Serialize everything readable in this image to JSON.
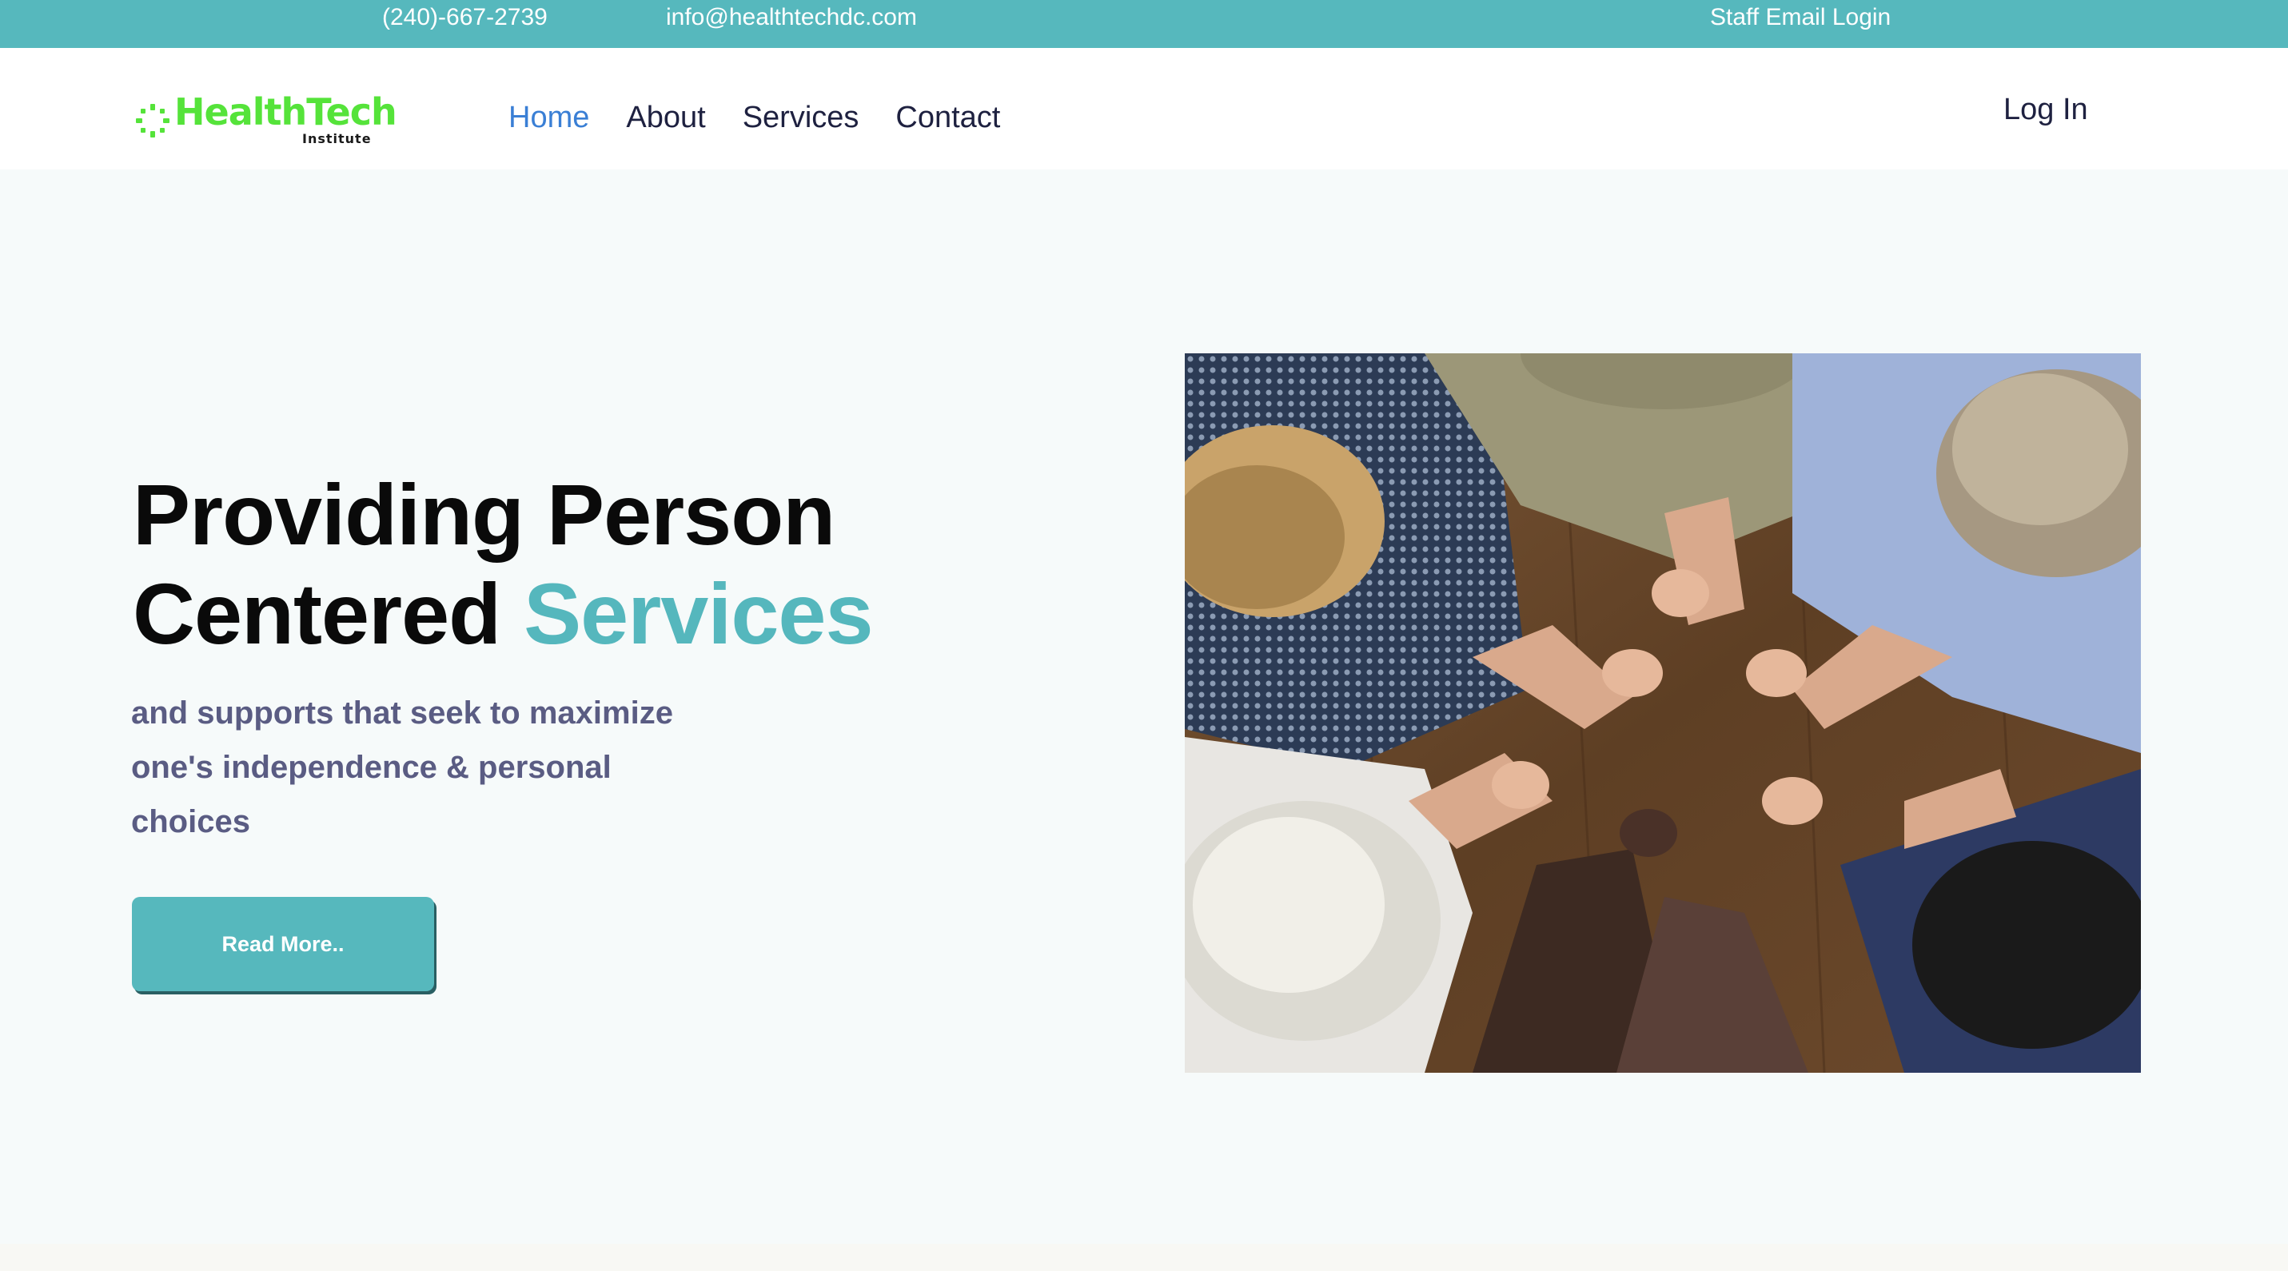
{
  "topbar": {
    "phone": "(240)-667-2739",
    "email": "info@healthtechdc.com",
    "staff_login": "Staff Email Login"
  },
  "brand": {
    "name": "HealthTech",
    "sub": "Institute",
    "primary_color": "#55e33a",
    "accent_color": "#56b8bd"
  },
  "nav": {
    "items": [
      {
        "label": "Home",
        "active": true
      },
      {
        "label": "About"
      },
      {
        "label": "Services"
      },
      {
        "label": "Contact"
      }
    ],
    "login": "Log In"
  },
  "hero": {
    "title_line1": "Providing Person",
    "title_line2": "Centered ",
    "title_accent": "Services",
    "subtitle": "and supports that seek to maximize one's independence & personal choices",
    "button": "Read More..",
    "image_icon": "people-holding-hands-photo"
  }
}
